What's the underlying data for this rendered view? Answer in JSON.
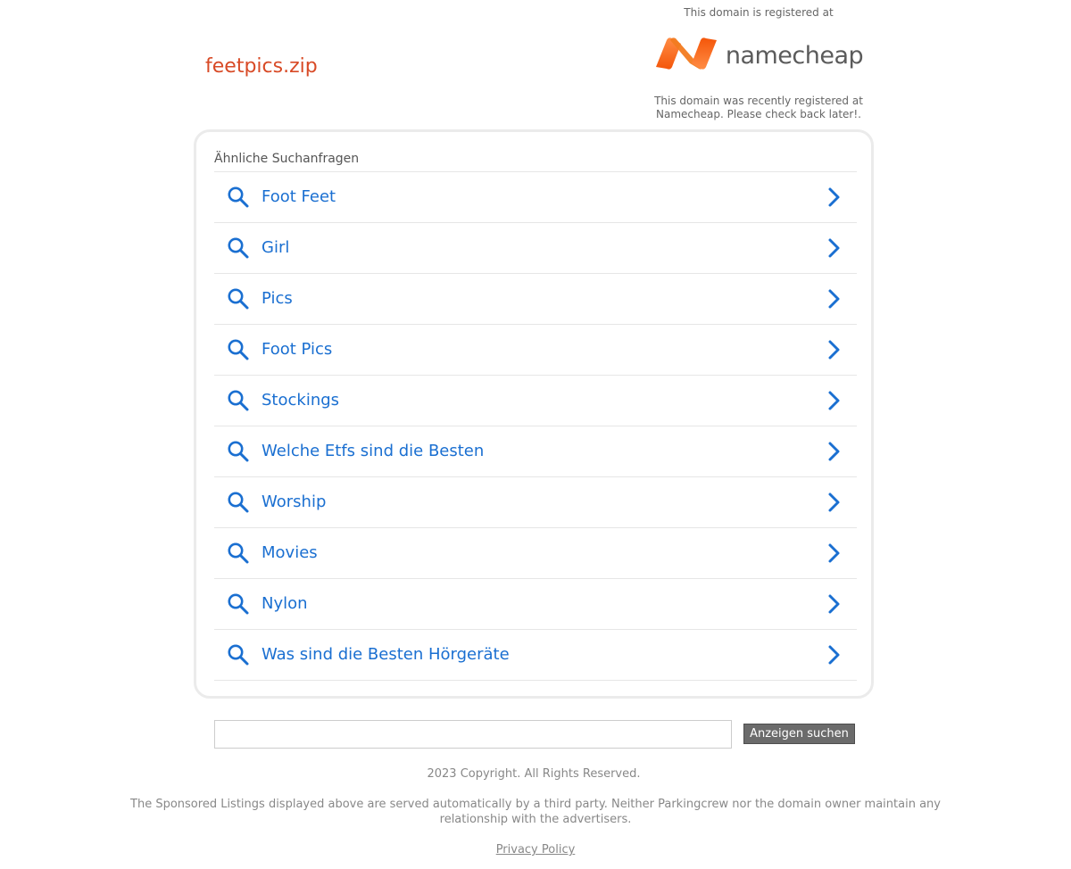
{
  "domain": {
    "name": "feetpics.zip"
  },
  "registrar": {
    "registered_at": "This domain is registered at",
    "logo_text": "namecheap",
    "note": "This domain was recently registered at Namecheap. Please check back later!.",
    "colors": {
      "logo_orange": "#f4560a",
      "logo_orange_light": "#ff8c44",
      "wordmark": "#5b5b5b"
    }
  },
  "related": {
    "heading": "Ähnliche Suchanfragen",
    "items": [
      {
        "label": "Foot Feet"
      },
      {
        "label": "Girl"
      },
      {
        "label": "Pics"
      },
      {
        "label": "Foot Pics"
      },
      {
        "label": "Stockings"
      },
      {
        "label": "Welche Etfs sind die Besten"
      },
      {
        "label": "Worship"
      },
      {
        "label": "Movies"
      },
      {
        "label": "Nylon"
      },
      {
        "label": "Was sind die Besten Hörgeräte"
      }
    ],
    "icons": {
      "left": "search-icon",
      "right": "chevron-right-icon"
    },
    "colors": {
      "link": "#1a6fd1"
    }
  },
  "search": {
    "value": "",
    "button_label": "Anzeigen suchen"
  },
  "footer": {
    "copyright": "2023 Copyright. All Rights Reserved.",
    "disclaimer": "The Sponsored Listings displayed above are served automatically by a third party. Neither Parkingcrew nor the domain owner maintain any relationship with the advertisers.",
    "privacy_label": "Privacy Policy"
  }
}
